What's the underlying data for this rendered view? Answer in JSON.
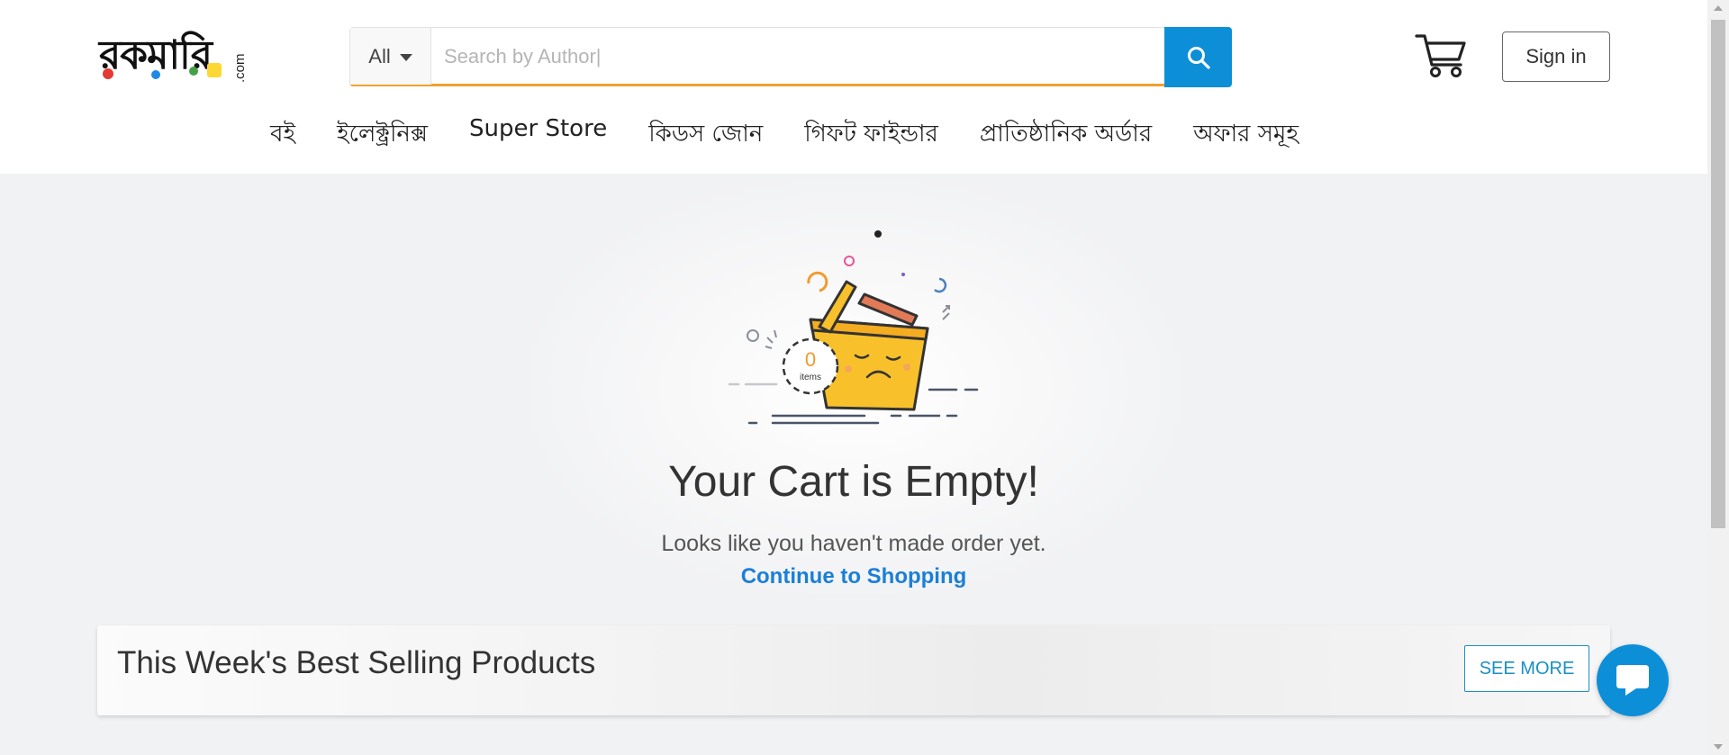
{
  "header": {
    "logo": {
      "text": "রকমারি",
      "suffix": ".com"
    },
    "search": {
      "category": "All",
      "placeholder": "Search by Author|"
    },
    "sign_in_label": "Sign in",
    "nav": [
      "বই",
      "ইলেক্ট্রনিক্স",
      "Super Store",
      "কিডস জোন",
      "গিফট ফাইন্ডার",
      "প্রাতিষ্ঠানিক অর্ডার",
      "অফার সমূহ"
    ]
  },
  "empty_cart": {
    "items_count": "0",
    "items_label": "items",
    "title": "Your Cart is Empty!",
    "subtitle": "Looks like you haven't made order yet.",
    "continue_label": "Continue to Shopping"
  },
  "best_selling": {
    "title": "This Week's Best Selling Products",
    "see_more_label": "SEE MORE"
  },
  "icons": [
    "search-icon",
    "cart-icon",
    "chat-icon",
    "caret-down-icon"
  ],
  "colors": {
    "brand_blue": "#0d8fd8",
    "link_blue": "#1b7fd6",
    "search_border": "#f1a02e",
    "basket_yellow": "#f8c12c"
  }
}
